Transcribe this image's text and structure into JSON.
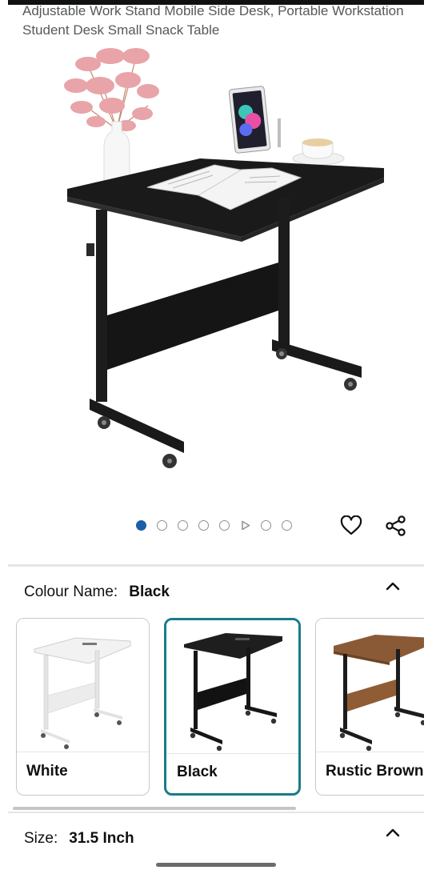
{
  "product": {
    "title": "Adjustable Work Stand Mobile Side Desk, Portable Workstation Student Desk Small Snack Table"
  },
  "gallery": {
    "image_count": 8,
    "active_index": 0,
    "video_index": 5
  },
  "actions": {
    "favorite_icon": "heart-icon",
    "share_icon": "share-icon"
  },
  "colour": {
    "label": "Colour Name:",
    "selected": "Black",
    "options": [
      {
        "label": "White",
        "desk_color": "#f4f4f4",
        "frame_color": "#e6e6e6"
      },
      {
        "label": "Black",
        "desk_color": "#1e1e1e",
        "frame_color": "#161616"
      },
      {
        "label": "Rustic Brown",
        "desk_color": "#8a5a36",
        "frame_color": "#1c1c1c"
      }
    ]
  },
  "size": {
    "label": "Size:",
    "selected": "31.5 Inch"
  },
  "colors": {
    "accent_selected": "#1a7c86",
    "dot_active": "#1b5fa8"
  }
}
